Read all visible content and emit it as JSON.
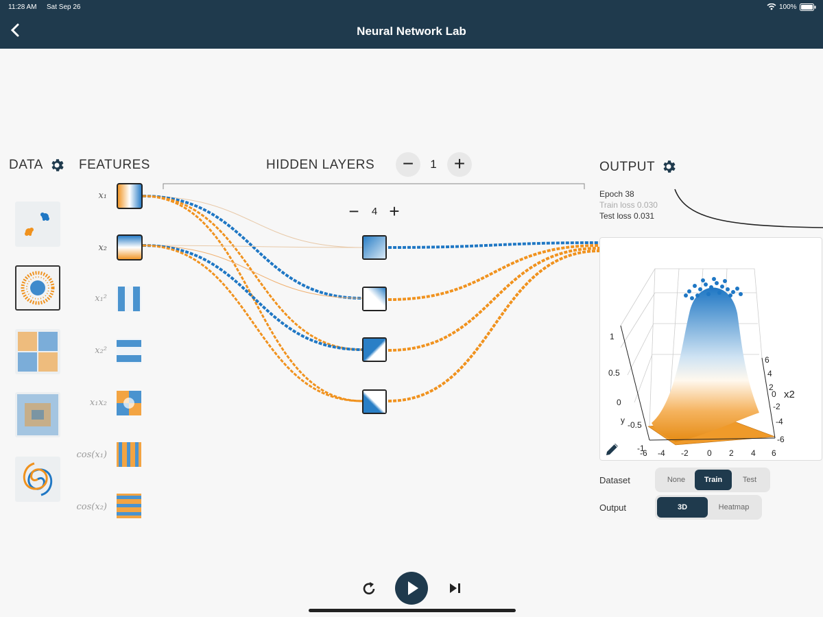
{
  "status_bar": {
    "time": "11:28 AM",
    "date": "Sat Sep 26",
    "battery": "100%"
  },
  "nav": {
    "title": "Neural Network Lab"
  },
  "sections": {
    "data": "DATA",
    "features": "FEATURES",
    "hidden_layers": "HIDDEN LAYERS",
    "output": "OUTPUT"
  },
  "hidden_layer_count": "1",
  "neuron_count": "4",
  "features": [
    {
      "name": "x1",
      "label": "x₁",
      "active": true
    },
    {
      "name": "x2",
      "label": "x₂",
      "active": true
    },
    {
      "name": "x1-squared",
      "label": "x₁²",
      "active": false
    },
    {
      "name": "x2-squared",
      "label": "x₂²",
      "active": false
    },
    {
      "name": "x1x2",
      "label": "x₁x₂",
      "active": false
    },
    {
      "name": "cos-x1",
      "label": "cos(x₁)",
      "active": false
    },
    {
      "name": "cos-x2",
      "label": "cos(x₂)",
      "active": false
    }
  ],
  "datasets": [
    "gaussian-clusters",
    "circle",
    "xor",
    "noisy-xor",
    "spiral"
  ],
  "selected_dataset": "circle",
  "stats": {
    "epoch": "Epoch 38",
    "train_loss": "Train loss 0.030",
    "test_loss": "Test loss 0.031"
  },
  "plot": {
    "z_ticks": [
      "1",
      "0.5",
      "0",
      "-0.5",
      "-1"
    ],
    "x_ticks": [
      "-6",
      "-4",
      "-2",
      "0",
      "2",
      "4",
      "6"
    ],
    "y_ticks": [
      "6",
      "4",
      "2",
      "0",
      "-2",
      "-4",
      "-6"
    ],
    "z_axis_label": "y",
    "y_axis_label": "x2"
  },
  "dataset_toggle": {
    "label": "Dataset",
    "options": [
      "None",
      "Train",
      "Test"
    ],
    "selected": "Train"
  },
  "output_toggle": {
    "label": "Output",
    "options": [
      "3D",
      "Heatmap"
    ],
    "selected": "3D"
  },
  "colors": {
    "positive": "#1f77c4",
    "negative": "#f0921e",
    "header": "#1f3a4d"
  },
  "icons": [
    "back-chevron-icon",
    "gear-icon",
    "minus-icon",
    "plus-icon",
    "pencil-icon",
    "reset-icon",
    "play-icon",
    "step-icon"
  ]
}
